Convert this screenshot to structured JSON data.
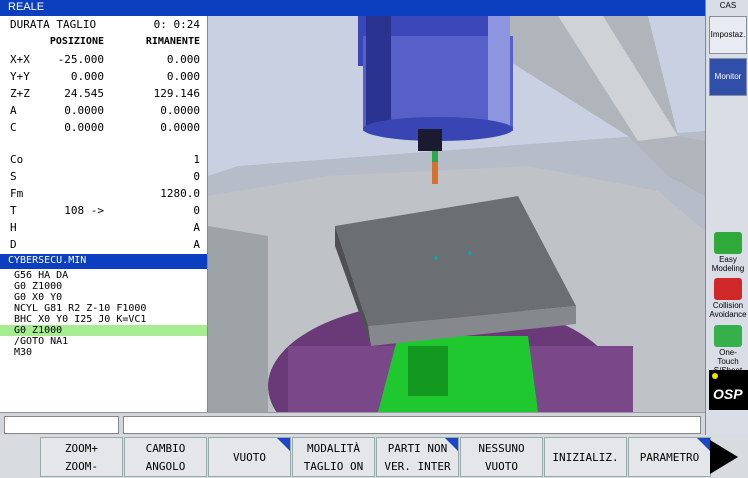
{
  "header": {
    "title": "REALE",
    "cas": "CAS"
  },
  "status": {
    "durata_label": "DURATA TAGLIO",
    "durata_value": "0: 0:24",
    "col_pos": "POSIZIONE",
    "col_rim": "RIMANENTE",
    "axes": [
      {
        "label": "X+X",
        "pos": "-25.000",
        "rim": "0.000"
      },
      {
        "label": "Y+Y",
        "pos": "0.000",
        "rim": "0.000"
      },
      {
        "label": "Z+Z",
        "pos": "24.545",
        "rim": "129.146"
      },
      {
        "label": "A",
        "pos": "0.0000",
        "rim": "0.0000"
      },
      {
        "label": "C",
        "pos": "0.0000",
        "rim": "0.0000"
      }
    ],
    "params": [
      {
        "label": "Co",
        "mid": "",
        "val": "1"
      },
      {
        "label": "S",
        "mid": "",
        "val": "0"
      },
      {
        "label": "Fm",
        "mid": "",
        "val": "1280.0"
      },
      {
        "label": "T",
        "mid": "108 ->",
        "val": "0"
      },
      {
        "label": "H",
        "mid": "",
        "val": "A"
      },
      {
        "label": "D",
        "mid": "",
        "val": "A"
      }
    ]
  },
  "program": {
    "name": "CYBERSECU.MIN",
    "lines": [
      "G56 HA DA",
      "G0 Z1000",
      "G0 X0 Y0",
      "NCYL G81 R2 Z-10 F1000",
      "BHC X0 Y0 I25 J0 K=VC1",
      "G0 Z1000",
      "/GOTO NA1",
      "M30"
    ],
    "current_line": 5
  },
  "sidebar": {
    "tab1": "Impostaz.",
    "tab2": "Monitor",
    "easy": "Easy Modeling",
    "collision": "Collision Avoidance",
    "onetouch": "One-Touch S/Sheet",
    "osp": "OSP"
  },
  "fkeys": {
    "k1a": "ZOOM+",
    "k1b": "ZOOM-",
    "k2a": "CAMBIO",
    "k2b": "ANGOLO",
    "k3": "VUOTO",
    "k4a": "MODALITÀ",
    "k4b": "TAGLIO ON",
    "k5a": "PARTI NON",
    "k5b": "VER. INTER",
    "k6a": "NESSUNO",
    "k6b": "VUOTO",
    "k7": "INIZIALIZ.",
    "k8": "PARAMETRO"
  },
  "colors": {
    "accent": "#0b3fbf",
    "highlight": "#a6ec90",
    "fkey_marker": "#1c46c8"
  }
}
